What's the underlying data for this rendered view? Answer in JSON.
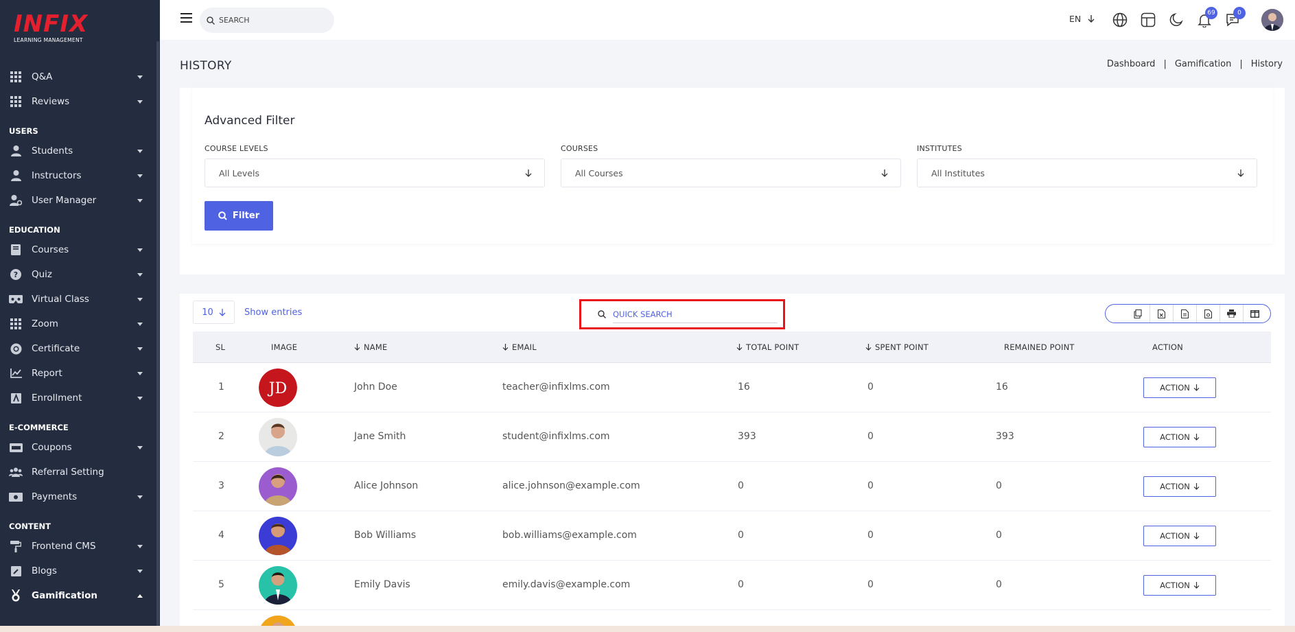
{
  "brand": {
    "logo": "INFIX",
    "tagline": "LEARNING MANAGEMENT"
  },
  "sidebar": {
    "items": [
      {
        "label": "Q&A",
        "icon": "grid-icon"
      },
      {
        "label": "Reviews",
        "icon": "grid-icon"
      }
    ],
    "sections": [
      {
        "title": "USERS",
        "items": [
          {
            "label": "Students",
            "icon": "user-icon"
          },
          {
            "label": "Instructors",
            "icon": "user-icon"
          },
          {
            "label": "User Manager",
            "icon": "user-cog-icon"
          }
        ]
      },
      {
        "title": "EDUCATION",
        "items": [
          {
            "label": "Courses",
            "icon": "book-icon"
          },
          {
            "label": "Quiz",
            "icon": "question-icon"
          },
          {
            "label": "Virtual Class",
            "icon": "vr-icon"
          },
          {
            "label": "Zoom",
            "icon": "grid-icon"
          },
          {
            "label": "Certificate",
            "icon": "certificate-icon"
          },
          {
            "label": "Report",
            "icon": "chart-icon"
          },
          {
            "label": "Enrollment",
            "icon": "enrollment-icon"
          }
        ]
      },
      {
        "title": "E-COMMERCE",
        "items": [
          {
            "label": "Coupons",
            "icon": "coupon-icon"
          },
          {
            "label": "Referral Setting",
            "icon": "users-icon"
          },
          {
            "label": "Payments",
            "icon": "money-icon"
          }
        ]
      },
      {
        "title": "CONTENT",
        "items": [
          {
            "label": "Frontend CMS",
            "icon": "paint-roller-icon"
          },
          {
            "label": "Blogs",
            "icon": "edit-icon"
          },
          {
            "label": "Gamification",
            "icon": "medal-icon"
          }
        ]
      }
    ]
  },
  "header": {
    "search_placeholder": "SEARCH",
    "language": "EN",
    "notifications_count": "69",
    "messages_count": "0"
  },
  "page": {
    "title": "HISTORY",
    "breadcrumb": [
      "Dashboard",
      "Gamification",
      "History"
    ]
  },
  "filter": {
    "title": "Advanced Filter",
    "course_levels_label": "COURSE LEVELS",
    "course_levels_value": "All Levels",
    "courses_label": "COURSES",
    "courses_value": "All Courses",
    "institutes_label": "INSTITUTES",
    "institutes_value": "All Institutes",
    "button": "Filter"
  },
  "table": {
    "entries_value": "10",
    "entries_label": "Show entries",
    "quick_search_placeholder": "QUICK SEARCH",
    "headers": {
      "sl": "SL",
      "image": "IMAGE",
      "name": "NAME",
      "email": "EMAIL",
      "total": "TOTAL POINT",
      "spent": "SPENT POINT",
      "remained": "REMAINED POINT",
      "action": "ACTION"
    },
    "rows": [
      {
        "sl": "1",
        "initials": "JD",
        "name": "John Doe",
        "email": "teacher@infixlms.com",
        "total": "16",
        "spent": "0",
        "remained": "16",
        "action": "ACTION"
      },
      {
        "sl": "2",
        "initials": "",
        "name": "Jane Smith",
        "email": "student@infixlms.com",
        "total": "393",
        "spent": "0",
        "remained": "393",
        "action": "ACTION"
      },
      {
        "sl": "3",
        "initials": "",
        "name": "Alice Johnson",
        "email": "alice.johnson@example.com",
        "total": "0",
        "spent": "0",
        "remained": "0",
        "action": "ACTION"
      },
      {
        "sl": "4",
        "initials": "",
        "name": "Bob Williams",
        "email": "bob.williams@example.com",
        "total": "0",
        "spent": "0",
        "remained": "0",
        "action": "ACTION"
      },
      {
        "sl": "5",
        "initials": "",
        "name": "Emily Davis",
        "email": "emily.davis@example.com",
        "total": "0",
        "spent": "0",
        "remained": "0",
        "action": "ACTION"
      }
    ]
  },
  "colors": {
    "accent": "#4f62e2",
    "sidebar": "#242c3f",
    "highlight": "#e8141a",
    "logo": "#e5202e"
  }
}
